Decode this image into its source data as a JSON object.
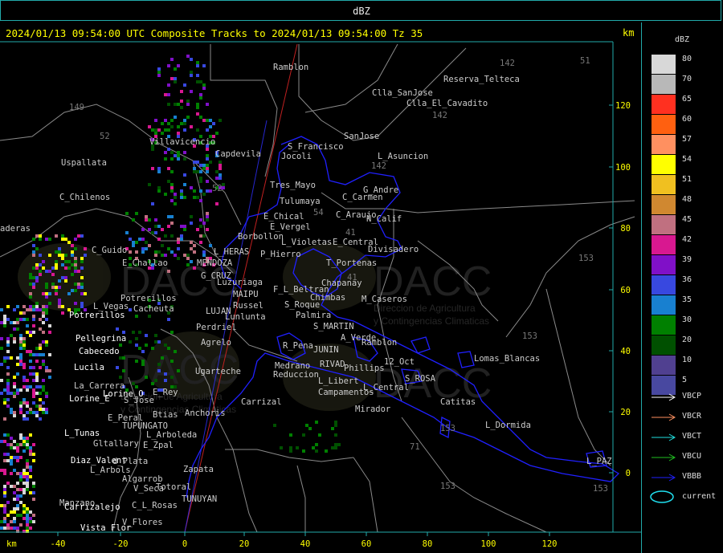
{
  "window": {
    "title": "dBZ"
  },
  "header": {
    "status": "2024/01/13 09:54:00 UTC Composite Tracks to 2024/01/13 09:54:00 Tz 35",
    "km_label": "km"
  },
  "axes": {
    "x_label": "km",
    "x_ticks": [
      "-40",
      "-20",
      "0",
      "20",
      "40",
      "60",
      "80",
      "100",
      "120"
    ],
    "y_ticks": [
      "120",
      "100",
      "80",
      "60",
      "40",
      "20",
      "0"
    ]
  },
  "legend": {
    "title": "dBZ",
    "scale": [
      {
        "value": "80",
        "color": "#d8d8d8"
      },
      {
        "value": "70",
        "color": "#b8b8b8"
      },
      {
        "value": "65",
        "color": "#ff3020"
      },
      {
        "value": "60",
        "color": "#ff6010"
      },
      {
        "value": "57",
        "color": "#ff9060"
      },
      {
        "value": "54",
        "color": "#ffff00"
      },
      {
        "value": "51",
        "color": "#f0c020"
      },
      {
        "value": "48",
        "color": "#d08830"
      },
      {
        "value": "45",
        "color": "#c07080"
      },
      {
        "value": "42",
        "color": "#d81890"
      },
      {
        "value": "39",
        "color": "#8010c8"
      },
      {
        "value": "36",
        "color": "#3848e0"
      },
      {
        "value": "35",
        "color": "#1880d0"
      },
      {
        "value": "30",
        "color": "#008000"
      },
      {
        "value": "20",
        "color": "#005000"
      },
      {
        "value": "10",
        "color": "#504090"
      },
      {
        "value": "5",
        "color": "#4848a0"
      }
    ],
    "tracks": [
      {
        "label": "VBCP",
        "color": "#ffffff"
      },
      {
        "label": "VBCR",
        "color": "#ff9060"
      },
      {
        "label": "VBCT",
        "color": "#20e0e0"
      },
      {
        "label": "VBCU",
        "color": "#20c020"
      },
      {
        "label": "VBBB",
        "color": "#2020ff"
      }
    ],
    "current": {
      "label": "current",
      "color": "#20e0f0"
    }
  },
  "places": [
    {
      "name": "Ramblon",
      "color": "#cccccc"
    },
    {
      "name": "Reserva_Telteca",
      "color": "#cccccc"
    },
    {
      "name": "Clla_SanJose",
      "color": "#cccccc"
    },
    {
      "name": "Clla_El_Cavadito",
      "color": "#cccccc"
    },
    {
      "name": "Uspallata",
      "color": "#cccccc"
    },
    {
      "name": "Villavicencio",
      "color": "#cccccc"
    },
    {
      "name": "Capdevila",
      "color": "#cccccc"
    },
    {
      "name": "S_Francisco",
      "color": "#cccccc"
    },
    {
      "name": "Jocoli",
      "color": "#cccccc"
    },
    {
      "name": "SanJose",
      "color": "#cccccc"
    },
    {
      "name": "L_Asuncion",
      "color": "#cccccc"
    },
    {
      "name": "C_Chilenos",
      "color": "#cccccc"
    },
    {
      "name": "Tres_Mayo",
      "color": "#cccccc"
    },
    {
      "name": "G_Andre",
      "color": "#cccccc"
    },
    {
      "name": "C_Carmen",
      "color": "#cccccc"
    },
    {
      "name": "Tulumaya",
      "color": "#cccccc"
    },
    {
      "name": "E_Chical",
      "color": "#cccccc"
    },
    {
      "name": "C_Araujo",
      "color": "#cccccc"
    },
    {
      "name": "E_Vergel",
      "color": "#cccccc"
    },
    {
      "name": "N_Calif",
      "color": "#cccccc"
    },
    {
      "name": "aderas",
      "color": "#cccccc"
    },
    {
      "name": "Borbollon",
      "color": "#cccccc"
    },
    {
      "name": "L_Violetas",
      "color": "#cccccc"
    },
    {
      "name": "E_Central",
      "color": "#cccccc"
    },
    {
      "name": "C_Guido",
      "color": "#cccccc"
    },
    {
      "name": "L_HERAS",
      "color": "#cccccc"
    },
    {
      "name": "P_Hierro",
      "color": "#cccccc"
    },
    {
      "name": "Divisadero",
      "color": "#cccccc"
    },
    {
      "name": "E_Challao",
      "color": "#cccccc"
    },
    {
      "name": "MENDOZA",
      "color": "#cccccc"
    },
    {
      "name": "T_Portenas",
      "color": "#cccccc"
    },
    {
      "name": "G_CRUZ",
      "color": "#cccccc"
    },
    {
      "name": "Luzuriaga",
      "color": "#cccccc"
    },
    {
      "name": "Chapanay",
      "color": "#cccccc"
    },
    {
      "name": "F_L_Beltran",
      "color": "#cccccc"
    },
    {
      "name": "Potrerillos",
      "color": "#cccccc"
    },
    {
      "name": "MAIPU",
      "color": "#cccccc"
    },
    {
      "name": "Chimbas",
      "color": "#cccccc"
    },
    {
      "name": "M_Caseros",
      "color": "#cccccc"
    },
    {
      "name": "L_Vegas",
      "color": "#cccccc"
    },
    {
      "name": "Cacheuta",
      "color": "#cccccc"
    },
    {
      "name": "Russel",
      "color": "#cccccc"
    },
    {
      "name": "S_Roque",
      "color": "#cccccc"
    },
    {
      "name": "LUJAN",
      "color": "#cccccc"
    },
    {
      "name": "Lunlunta",
      "color": "#cccccc"
    },
    {
      "name": "Palmira",
      "color": "#cccccc"
    },
    {
      "name": "Potrerillos",
      "color": "#ffffff"
    },
    {
      "name": "Perdriel",
      "color": "#cccccc"
    },
    {
      "name": "S_MARTIN",
      "color": "#cccccc"
    },
    {
      "name": "Pellegrina",
      "color": "#ffffff"
    },
    {
      "name": "A_Verde",
      "color": "#cccccc"
    },
    {
      "name": "Ramblon",
      "color": "#cccccc"
    },
    {
      "name": "Agrelo",
      "color": "#cccccc"
    },
    {
      "name": "R_Pena",
      "color": "#cccccc"
    },
    {
      "name": "JUNIN",
      "color": "#cccccc"
    },
    {
      "name": "Cabecedo",
      "color": "#ffffff"
    },
    {
      "name": "Lomas_Blancas",
      "color": "#cccccc"
    },
    {
      "name": "12_Oct",
      "color": "#cccccc"
    },
    {
      "name": "Medrano",
      "color": "#cccccc"
    },
    {
      "name": "RIVAD",
      "color": "#cccccc"
    },
    {
      "name": "Phillips",
      "color": "#cccccc"
    },
    {
      "name": "Lucila",
      "color": "#ffffff"
    },
    {
      "name": "Ugarteche",
      "color": "#cccccc"
    },
    {
      "name": "Reduccion",
      "color": "#cccccc"
    },
    {
      "name": "S_ROSA",
      "color": "#cccccc"
    },
    {
      "name": "L_Libert",
      "color": "#cccccc"
    },
    {
      "name": "La_Carrera",
      "color": "#cccccc"
    },
    {
      "name": "L_Central",
      "color": "#cccccc"
    },
    {
      "name": "Campamentos",
      "color": "#cccccc"
    },
    {
      "name": "Lorine_E",
      "color": "#ffffff"
    },
    {
      "name": "Lorine_O",
      "color": "#ffffff"
    },
    {
      "name": "E_Rey",
      "color": "#cccccc"
    },
    {
      "name": "S_Jose",
      "color": "#cccccc"
    },
    {
      "name": "Carrizal",
      "color": "#cccccc"
    },
    {
      "name": "Catitas",
      "color": "#cccccc"
    },
    {
      "name": "Mirador",
      "color": "#cccccc"
    },
    {
      "name": "E_Peral",
      "color": "#cccccc"
    },
    {
      "name": "Btias",
      "color": "#cccccc"
    },
    {
      "name": "Anchoris",
      "color": "#cccccc"
    },
    {
      "name": "TUPUNGATO",
      "color": "#cccccc"
    },
    {
      "name": "L_Dormida",
      "color": "#cccccc"
    },
    {
      "name": "L_Tunas",
      "color": "#ffffff"
    },
    {
      "name": "L_Arboleda",
      "color": "#cccccc"
    },
    {
      "name": "Gltallary",
      "color": "#cccccc"
    },
    {
      "name": "E_Zpal",
      "color": "#cccccc"
    },
    {
      "name": "Diaz_Valent",
      "color": "#ffffff"
    },
    {
      "name": "d_Plata",
      "color": "#cccccc"
    },
    {
      "name": "L_PAZ",
      "color": "#cccccc"
    },
    {
      "name": "L_Arbols",
      "color": "#cccccc"
    },
    {
      "name": "Zapata",
      "color": "#cccccc"
    },
    {
      "name": "Algarrob",
      "color": "#cccccc"
    },
    {
      "name": "V_Seca",
      "color": "#cccccc"
    },
    {
      "name": "Totoral",
      "color": "#cccccc"
    },
    {
      "name": "Manzano",
      "color": "#cccccc"
    },
    {
      "name": "Carrizalejo",
      "color": "#ffffff"
    },
    {
      "name": "C_L_Rosas",
      "color": "#cccccc"
    },
    {
      "name": "TUNUYAN",
      "color": "#cccccc"
    },
    {
      "name": "V_Flores",
      "color": "#cccccc"
    },
    {
      "name": "Vista_Flor",
      "color": "#ffffff"
    }
  ],
  "elevations": [
    "142",
    "51",
    "149",
    "142",
    "52",
    "142",
    "52",
    "54",
    "41",
    "153",
    "153",
    "153",
    "41",
    "153",
    "71",
    "153"
  ],
  "watermark": {
    "brand": "DACC",
    "line1": "Direccion de Agricultura",
    "line2": "y Contingencias Climaticas"
  }
}
